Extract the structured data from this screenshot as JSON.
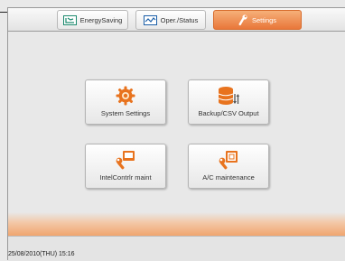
{
  "tabs": [
    {
      "label": "EnergySaving",
      "icon": "energy-saving-icon",
      "active": false
    },
    {
      "label": "Oper./Status",
      "icon": "monitor-icon",
      "active": false
    },
    {
      "label": "Settings",
      "icon": "wrench-icon",
      "active": true
    }
  ],
  "tiles": [
    {
      "label": "System Settings",
      "icon": "gear-icon"
    },
    {
      "label": "Backup/CSV Output",
      "icon": "database-icon"
    },
    {
      "label": "IntelContrlr maint",
      "icon": "controller-wrench-icon"
    },
    {
      "label": "A/C maintenance",
      "icon": "ac-unit-wrench-icon"
    }
  ],
  "status": {
    "datetime": "25/08/2010(THU) 15:16"
  },
  "colors": {
    "accent": "#ec8040",
    "accent_dark": "#d76b2c",
    "background": "#e8e8e8",
    "icon_orange": "#e8731e"
  }
}
